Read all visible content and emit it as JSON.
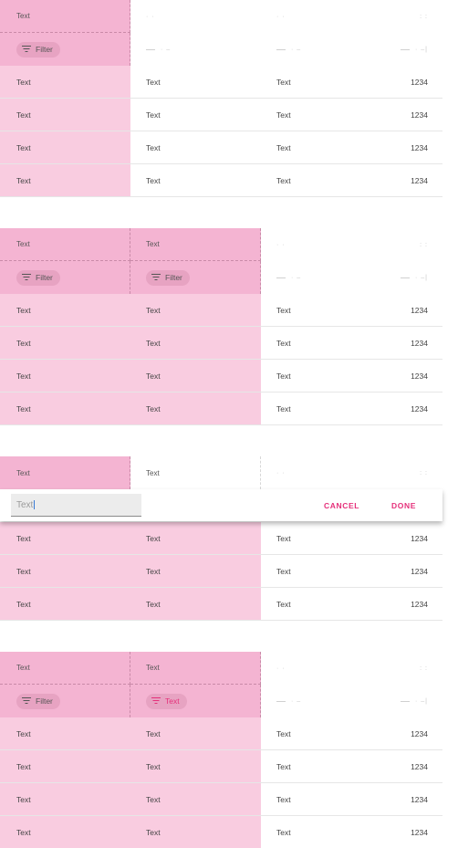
{
  "accent_color": "#e5307a",
  "selection_colors": {
    "header": "#f4b4d2",
    "body": "#f9cce0"
  },
  "icons": [
    "filter-icon"
  ],
  "cell_text": "Text",
  "numeric_value": "1234",
  "filter_label": "Filter",
  "faint_header_glyph": "· ·",
  "faint_sort_glyph": "· –",
  "faint_end_glyph": ": :",
  "faint_end_sort": "· –|",
  "table1": {
    "header": [
      "Text"
    ],
    "filter": [
      "Filter"
    ],
    "rows": [
      [
        "Text",
        "Text",
        "Text",
        "1234"
      ],
      [
        "Text",
        "Text",
        "Text",
        "1234"
      ],
      [
        "Text",
        "Text",
        "Text",
        "1234"
      ],
      [
        "Text",
        "Text",
        "Text",
        "1234"
      ]
    ]
  },
  "table2": {
    "header": [
      "Text",
      "Text"
    ],
    "filter": [
      "Filter",
      "Filter"
    ],
    "rows": [
      [
        "Text",
        "Text",
        "Text",
        "1234"
      ],
      [
        "Text",
        "Text",
        "Text",
        "1234"
      ],
      [
        "Text",
        "Text",
        "Text",
        "1234"
      ],
      [
        "Text",
        "Text",
        "Text",
        "1234"
      ]
    ]
  },
  "table3": {
    "header": [
      "Text",
      "Text"
    ],
    "edit_value": "Text",
    "cancel_label": "CANCEL",
    "done_label": "DONE",
    "rows": [
      [
        "Text",
        "Text",
        "Text",
        "1234"
      ],
      [
        "Text",
        "Text",
        "Text",
        "1234"
      ],
      [
        "Text",
        "Text",
        "Text",
        "1234"
      ]
    ]
  },
  "table4": {
    "header": [
      "Text",
      "Text"
    ],
    "filter": [
      "Filter",
      "Text"
    ],
    "rows": [
      [
        "Text",
        "Text",
        "Text",
        "1234"
      ],
      [
        "Text",
        "Text",
        "Text",
        "1234"
      ],
      [
        "Text",
        "Text",
        "Text",
        "1234"
      ],
      [
        "Text",
        "Text",
        "Text",
        "1234"
      ]
    ]
  }
}
